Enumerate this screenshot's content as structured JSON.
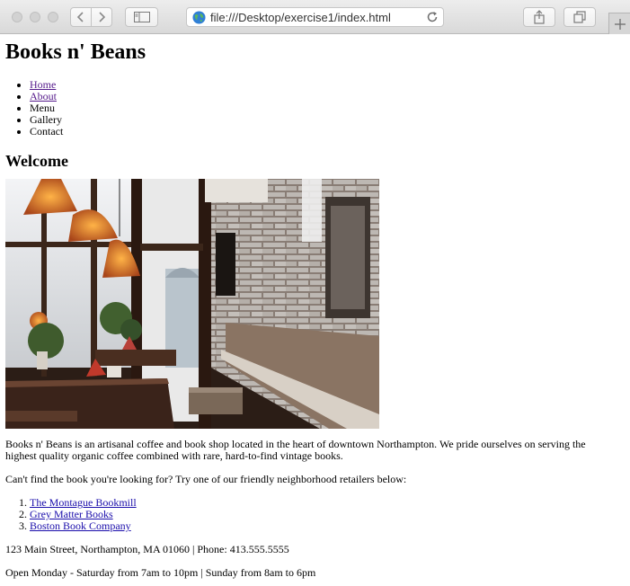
{
  "browser": {
    "url": "file:///Desktop/exercise1/index.html"
  },
  "site": {
    "title": "Books n' Beans",
    "nav": [
      "Home",
      "About",
      "Menu",
      "Gallery",
      "Contact"
    ],
    "heading": "Welcome",
    "intro": "Books n' Beans is an artisanal coffee and book shop located in the heart of downtown Northampton. We pride ourselves on serving the highest quality organic coffee combined with rare, hard-to-find vintage books.",
    "find_prompt": "Can't find the book you're looking for? Try one of our friendly neighborhood retailers below:",
    "retailers": [
      "The Montague Bookmill",
      "Grey Matter Books",
      "Boston Book Company"
    ],
    "address": "123 Main Street, Northampton, MA 01060 | Phone: 413.555.5555",
    "hours": "Open Monday - Saturday from 7am to 10pm | Sunday from 8am to 6pm"
  },
  "colors": {
    "link": "#1a0dab",
    "visited_link": "#551a8b"
  },
  "icons": {
    "close": "traffic-light-close-icon",
    "minimize": "traffic-light-minimize-icon",
    "maximize": "traffic-light-maximize-icon",
    "back": "chevron-left-icon",
    "forward": "chevron-right-icon",
    "sidebar": "sidebar-icon",
    "site": "globe-icon",
    "reload": "reload-icon",
    "share": "share-icon",
    "tabs": "tabs-overview-icon",
    "new_tab": "plus-icon"
  }
}
